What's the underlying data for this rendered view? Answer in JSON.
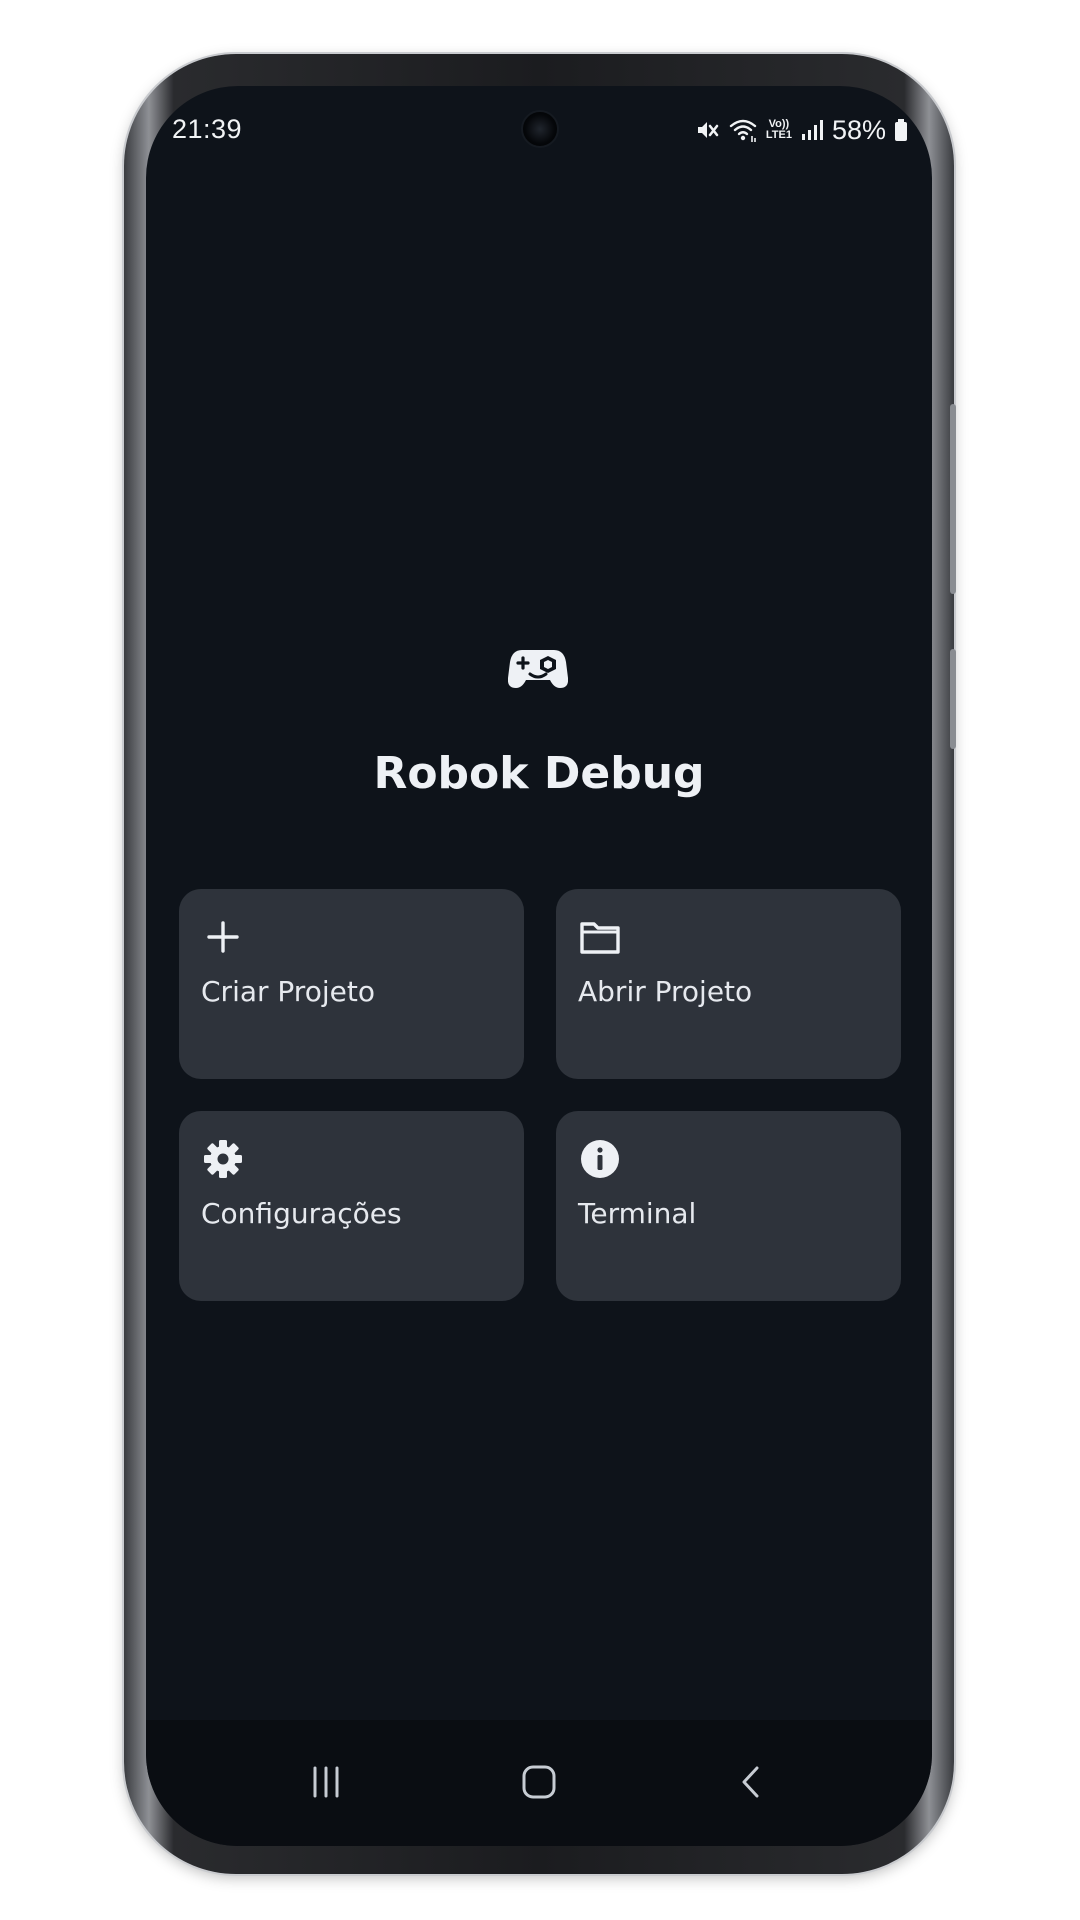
{
  "status_bar": {
    "time": "21:39",
    "volte_top": "Vo))",
    "volte_bottom": "LTE1",
    "battery": "58%",
    "icons": [
      "mute-icon",
      "wifi-icon",
      "volte-lte-icon",
      "signal-icon",
      "battery-icon"
    ]
  },
  "app": {
    "title": "Robok Debug",
    "logo_icon": "gamepad-icon"
  },
  "actions": [
    {
      "label": "Criar Projeto",
      "icon": "plus-icon"
    },
    {
      "label": "Abrir Projeto",
      "icon": "folder-icon"
    },
    {
      "label": "Configurações",
      "icon": "gear-icon"
    },
    {
      "label": "Terminal",
      "icon": "info-icon"
    }
  ],
  "nav_bar": {
    "buttons": [
      "recents-icon",
      "home-icon",
      "back-icon"
    ]
  },
  "colors": {
    "background": "#0e131a",
    "card": "#2e333b",
    "text": "#e6e9ee"
  }
}
